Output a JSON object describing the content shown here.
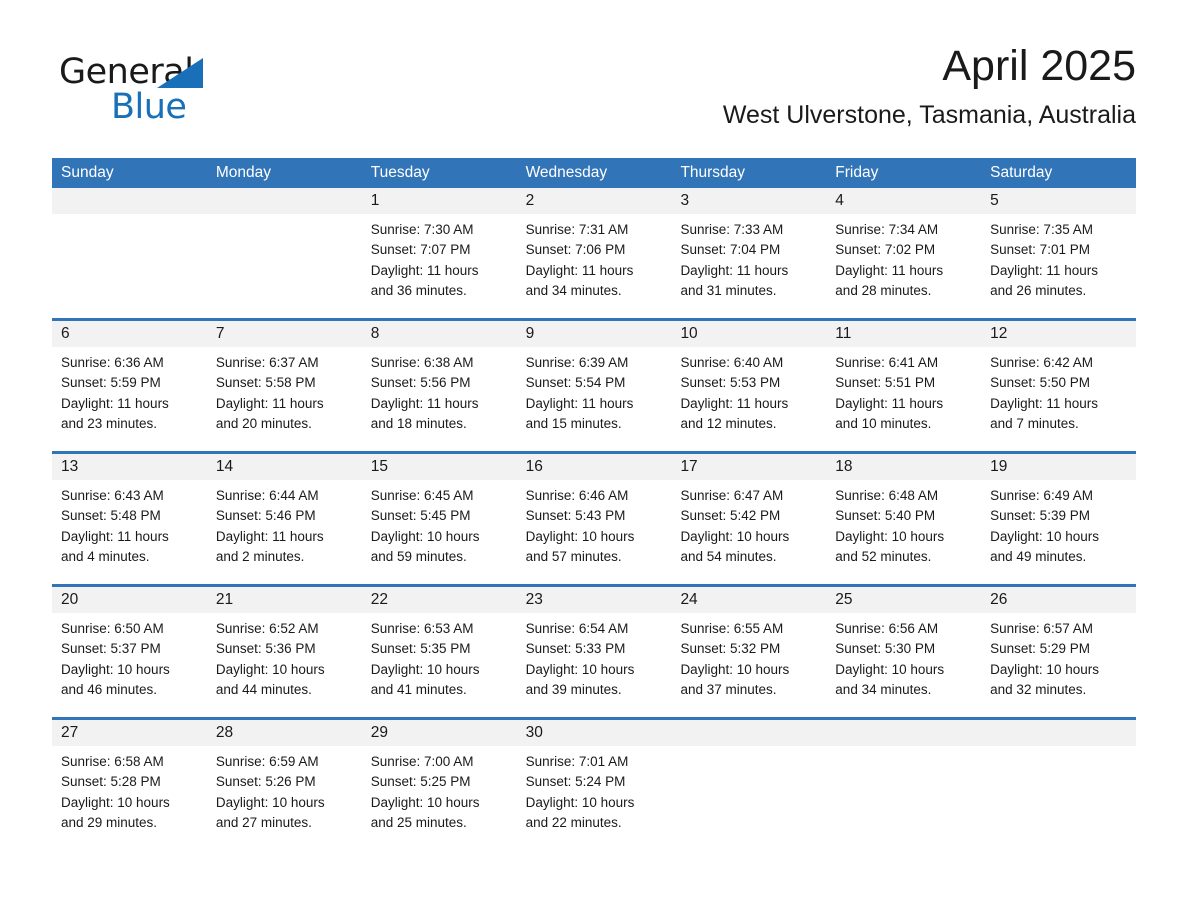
{
  "logo": {
    "word1": "General",
    "word2": "Blue",
    "triangle_color": "#1a70b8"
  },
  "header": {
    "month_title": "April 2025",
    "location": "West Ulverstone, Tasmania, Australia"
  },
  "theme": {
    "header_blue": "#3174b8",
    "number_band": "#f2f2f2",
    "text": "#1a1a1a"
  },
  "weekday_headers": [
    "Sunday",
    "Monday",
    "Tuesday",
    "Wednesday",
    "Thursday",
    "Friday",
    "Saturday"
  ],
  "weeks": [
    {
      "days": [
        {
          "num": "",
          "l1": "",
          "l2": "",
          "l3": "",
          "l4": ""
        },
        {
          "num": "",
          "l1": "",
          "l2": "",
          "l3": "",
          "l4": ""
        },
        {
          "num": "1",
          "l1": "Sunrise: 7:30 AM",
          "l2": "Sunset: 7:07 PM",
          "l3": "Daylight: 11 hours",
          "l4": "and 36 minutes."
        },
        {
          "num": "2",
          "l1": "Sunrise: 7:31 AM",
          "l2": "Sunset: 7:06 PM",
          "l3": "Daylight: 11 hours",
          "l4": "and 34 minutes."
        },
        {
          "num": "3",
          "l1": "Sunrise: 7:33 AM",
          "l2": "Sunset: 7:04 PM",
          "l3": "Daylight: 11 hours",
          "l4": "and 31 minutes."
        },
        {
          "num": "4",
          "l1": "Sunrise: 7:34 AM",
          "l2": "Sunset: 7:02 PM",
          "l3": "Daylight: 11 hours",
          "l4": "and 28 minutes."
        },
        {
          "num": "5",
          "l1": "Sunrise: 7:35 AM",
          "l2": "Sunset: 7:01 PM",
          "l3": "Daylight: 11 hours",
          "l4": "and 26 minutes."
        }
      ]
    },
    {
      "days": [
        {
          "num": "6",
          "l1": "Sunrise: 6:36 AM",
          "l2": "Sunset: 5:59 PM",
          "l3": "Daylight: 11 hours",
          "l4": "and 23 minutes."
        },
        {
          "num": "7",
          "l1": "Sunrise: 6:37 AM",
          "l2": "Sunset: 5:58 PM",
          "l3": "Daylight: 11 hours",
          "l4": "and 20 minutes."
        },
        {
          "num": "8",
          "l1": "Sunrise: 6:38 AM",
          "l2": "Sunset: 5:56 PM",
          "l3": "Daylight: 11 hours",
          "l4": "and 18 minutes."
        },
        {
          "num": "9",
          "l1": "Sunrise: 6:39 AM",
          "l2": "Sunset: 5:54 PM",
          "l3": "Daylight: 11 hours",
          "l4": "and 15 minutes."
        },
        {
          "num": "10",
          "l1": "Sunrise: 6:40 AM",
          "l2": "Sunset: 5:53 PM",
          "l3": "Daylight: 11 hours",
          "l4": "and 12 minutes."
        },
        {
          "num": "11",
          "l1": "Sunrise: 6:41 AM",
          "l2": "Sunset: 5:51 PM",
          "l3": "Daylight: 11 hours",
          "l4": "and 10 minutes."
        },
        {
          "num": "12",
          "l1": "Sunrise: 6:42 AM",
          "l2": "Sunset: 5:50 PM",
          "l3": "Daylight: 11 hours",
          "l4": "and 7 minutes."
        }
      ]
    },
    {
      "days": [
        {
          "num": "13",
          "l1": "Sunrise: 6:43 AM",
          "l2": "Sunset: 5:48 PM",
          "l3": "Daylight: 11 hours",
          "l4": "and 4 minutes."
        },
        {
          "num": "14",
          "l1": "Sunrise: 6:44 AM",
          "l2": "Sunset: 5:46 PM",
          "l3": "Daylight: 11 hours",
          "l4": "and 2 minutes."
        },
        {
          "num": "15",
          "l1": "Sunrise: 6:45 AM",
          "l2": "Sunset: 5:45 PM",
          "l3": "Daylight: 10 hours",
          "l4": "and 59 minutes."
        },
        {
          "num": "16",
          "l1": "Sunrise: 6:46 AM",
          "l2": "Sunset: 5:43 PM",
          "l3": "Daylight: 10 hours",
          "l4": "and 57 minutes."
        },
        {
          "num": "17",
          "l1": "Sunrise: 6:47 AM",
          "l2": "Sunset: 5:42 PM",
          "l3": "Daylight: 10 hours",
          "l4": "and 54 minutes."
        },
        {
          "num": "18",
          "l1": "Sunrise: 6:48 AM",
          "l2": "Sunset: 5:40 PM",
          "l3": "Daylight: 10 hours",
          "l4": "and 52 minutes."
        },
        {
          "num": "19",
          "l1": "Sunrise: 6:49 AM",
          "l2": "Sunset: 5:39 PM",
          "l3": "Daylight: 10 hours",
          "l4": "and 49 minutes."
        }
      ]
    },
    {
      "days": [
        {
          "num": "20",
          "l1": "Sunrise: 6:50 AM",
          "l2": "Sunset: 5:37 PM",
          "l3": "Daylight: 10 hours",
          "l4": "and 46 minutes."
        },
        {
          "num": "21",
          "l1": "Sunrise: 6:52 AM",
          "l2": "Sunset: 5:36 PM",
          "l3": "Daylight: 10 hours",
          "l4": "and 44 minutes."
        },
        {
          "num": "22",
          "l1": "Sunrise: 6:53 AM",
          "l2": "Sunset: 5:35 PM",
          "l3": "Daylight: 10 hours",
          "l4": "and 41 minutes."
        },
        {
          "num": "23",
          "l1": "Sunrise: 6:54 AM",
          "l2": "Sunset: 5:33 PM",
          "l3": "Daylight: 10 hours",
          "l4": "and 39 minutes."
        },
        {
          "num": "24",
          "l1": "Sunrise: 6:55 AM",
          "l2": "Sunset: 5:32 PM",
          "l3": "Daylight: 10 hours",
          "l4": "and 37 minutes."
        },
        {
          "num": "25",
          "l1": "Sunrise: 6:56 AM",
          "l2": "Sunset: 5:30 PM",
          "l3": "Daylight: 10 hours",
          "l4": "and 34 minutes."
        },
        {
          "num": "26",
          "l1": "Sunrise: 6:57 AM",
          "l2": "Sunset: 5:29 PM",
          "l3": "Daylight: 10 hours",
          "l4": "and 32 minutes."
        }
      ]
    },
    {
      "days": [
        {
          "num": "27",
          "l1": "Sunrise: 6:58 AM",
          "l2": "Sunset: 5:28 PM",
          "l3": "Daylight: 10 hours",
          "l4": "and 29 minutes."
        },
        {
          "num": "28",
          "l1": "Sunrise: 6:59 AM",
          "l2": "Sunset: 5:26 PM",
          "l3": "Daylight: 10 hours",
          "l4": "and 27 minutes."
        },
        {
          "num": "29",
          "l1": "Sunrise: 7:00 AM",
          "l2": "Sunset: 5:25 PM",
          "l3": "Daylight: 10 hours",
          "l4": "and 25 minutes."
        },
        {
          "num": "30",
          "l1": "Sunrise: 7:01 AM",
          "l2": "Sunset: 5:24 PM",
          "l3": "Daylight: 10 hours",
          "l4": "and 22 minutes."
        },
        {
          "num": "",
          "l1": "",
          "l2": "",
          "l3": "",
          "l4": ""
        },
        {
          "num": "",
          "l1": "",
          "l2": "",
          "l3": "",
          "l4": ""
        },
        {
          "num": "",
          "l1": "",
          "l2": "",
          "l3": "",
          "l4": ""
        }
      ]
    }
  ]
}
